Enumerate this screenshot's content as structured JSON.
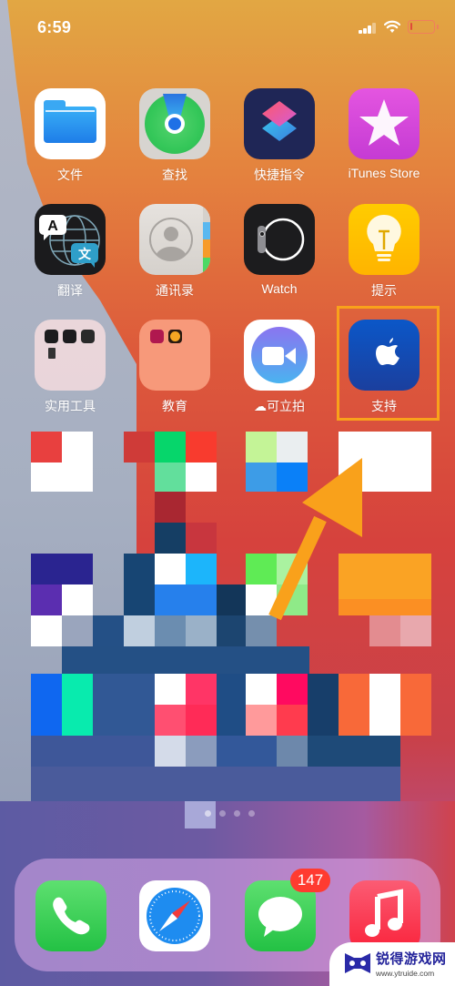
{
  "status_bar": {
    "time": "6:59",
    "signal_icon": "cellular-signal-icon",
    "wifi_icon": "wifi-icon",
    "battery_icon": "battery-low-icon",
    "battery_level_percent": 5
  },
  "home_screen": {
    "rows": [
      [
        {
          "label": "文件",
          "icon": "files-icon"
        },
        {
          "label": "查找",
          "icon": "find-my-icon"
        },
        {
          "label": "快捷指令",
          "icon": "shortcuts-icon"
        },
        {
          "label": "iTunes Store",
          "icon": "itunes-store-icon"
        }
      ],
      [
        {
          "label": "翻译",
          "icon": "translate-icon"
        },
        {
          "label": "通讯录",
          "icon": "contacts-icon"
        },
        {
          "label": "Watch",
          "icon": "watch-icon"
        },
        {
          "label": "提示",
          "icon": "tips-icon"
        }
      ],
      [
        {
          "label": "实用工具",
          "icon": "utilities-folder-icon"
        },
        {
          "label": "教育",
          "icon": "education-folder-icon"
        },
        {
          "label": "可立拍",
          "icon": "clips-icon",
          "prefix_icon": "icloud-download-icon"
        },
        {
          "label": "支持",
          "icon": "apple-support-icon",
          "highlighted": true
        }
      ]
    ],
    "translate_glyphs": {
      "latin": "A",
      "chinese": "文"
    },
    "pixelated_region_note": "censored",
    "annotation": {
      "type": "arrow",
      "target": "支持",
      "color": "#f9a11b",
      "box_color": "#f9a11b"
    }
  },
  "dock": {
    "apps": [
      {
        "label": "电话",
        "icon": "phone-icon"
      },
      {
        "label": "Safari",
        "icon": "safari-icon"
      },
      {
        "label": "信息",
        "icon": "messages-icon",
        "badge": "147"
      },
      {
        "label": "音乐",
        "icon": "music-icon"
      }
    ]
  },
  "watermark": {
    "title": "锐得游戏网",
    "url": "www.ytruide.com"
  },
  "colors": {
    "highlight": "#f9a11b",
    "badge": "#ff3b30"
  }
}
